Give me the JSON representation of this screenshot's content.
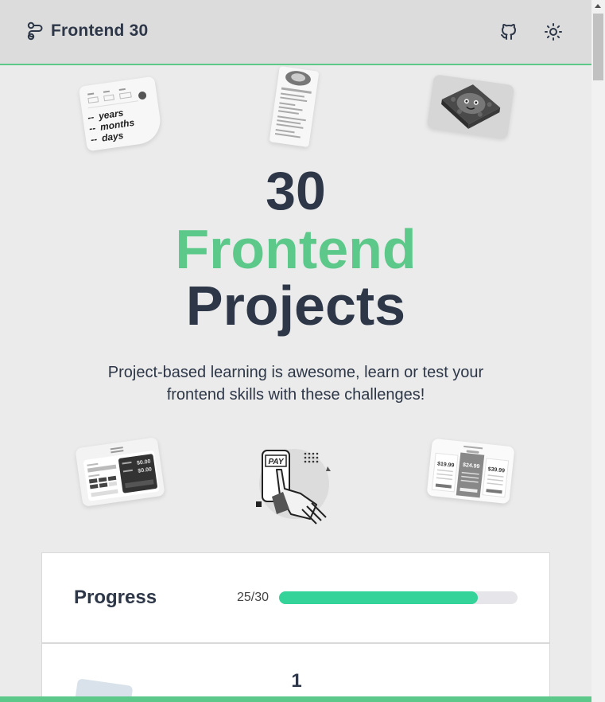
{
  "header": {
    "brand": "Frontend 30",
    "brand_icon": "route-icon",
    "github_icon": "github-icon",
    "theme_icon": "sun-icon"
  },
  "hero": {
    "line1": "30",
    "line2": "Frontend",
    "line3": "Projects",
    "subtitle": "Project-based learning is awesome, learn or test your frontend skills with these challenges!"
  },
  "previews": {
    "age": {
      "labels": [
        "--",
        "years",
        "--",
        "months",
        "--",
        "days"
      ]
    },
    "pay": {
      "label": "PAY"
    },
    "tip": {
      "values": [
        "$0.00",
        "$0.00"
      ]
    },
    "pricing": {
      "prices": [
        "$19.99",
        "$24.99",
        "$39.99"
      ]
    }
  },
  "progress": {
    "label": "Progress",
    "count": "25/30",
    "completed": 25,
    "total": 30
  },
  "projects": {
    "first_number": "1"
  },
  "colors": {
    "accent": "#5cc98a",
    "progress_fill": "#34d399",
    "text": "#2d3748",
    "background": "#ebebeb"
  }
}
